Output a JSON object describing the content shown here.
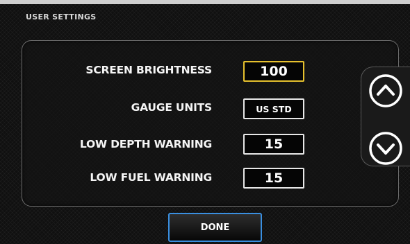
{
  "screen": {
    "title": "USER SETTINGS"
  },
  "settings": [
    {
      "label": "SCREEN BRIGHTNESS",
      "value": "100",
      "selected": true
    },
    {
      "label": "GAUGE UNITS",
      "value": "US STD",
      "selected": false
    },
    {
      "label": "LOW DEPTH WARNING",
      "value": "15",
      "selected": false
    },
    {
      "label": "LOW FUEL WARNING",
      "value": "15",
      "selected": false
    }
  ],
  "scroll": {
    "up_icon": "chevron-up-circle-icon",
    "down_icon": "chevron-down-circle-icon"
  },
  "footer": {
    "done_label": "DONE"
  },
  "colors": {
    "selected_border": "#e6c12e",
    "done_border": "#3a8fe0",
    "box_border": "#e8e8e8"
  }
}
